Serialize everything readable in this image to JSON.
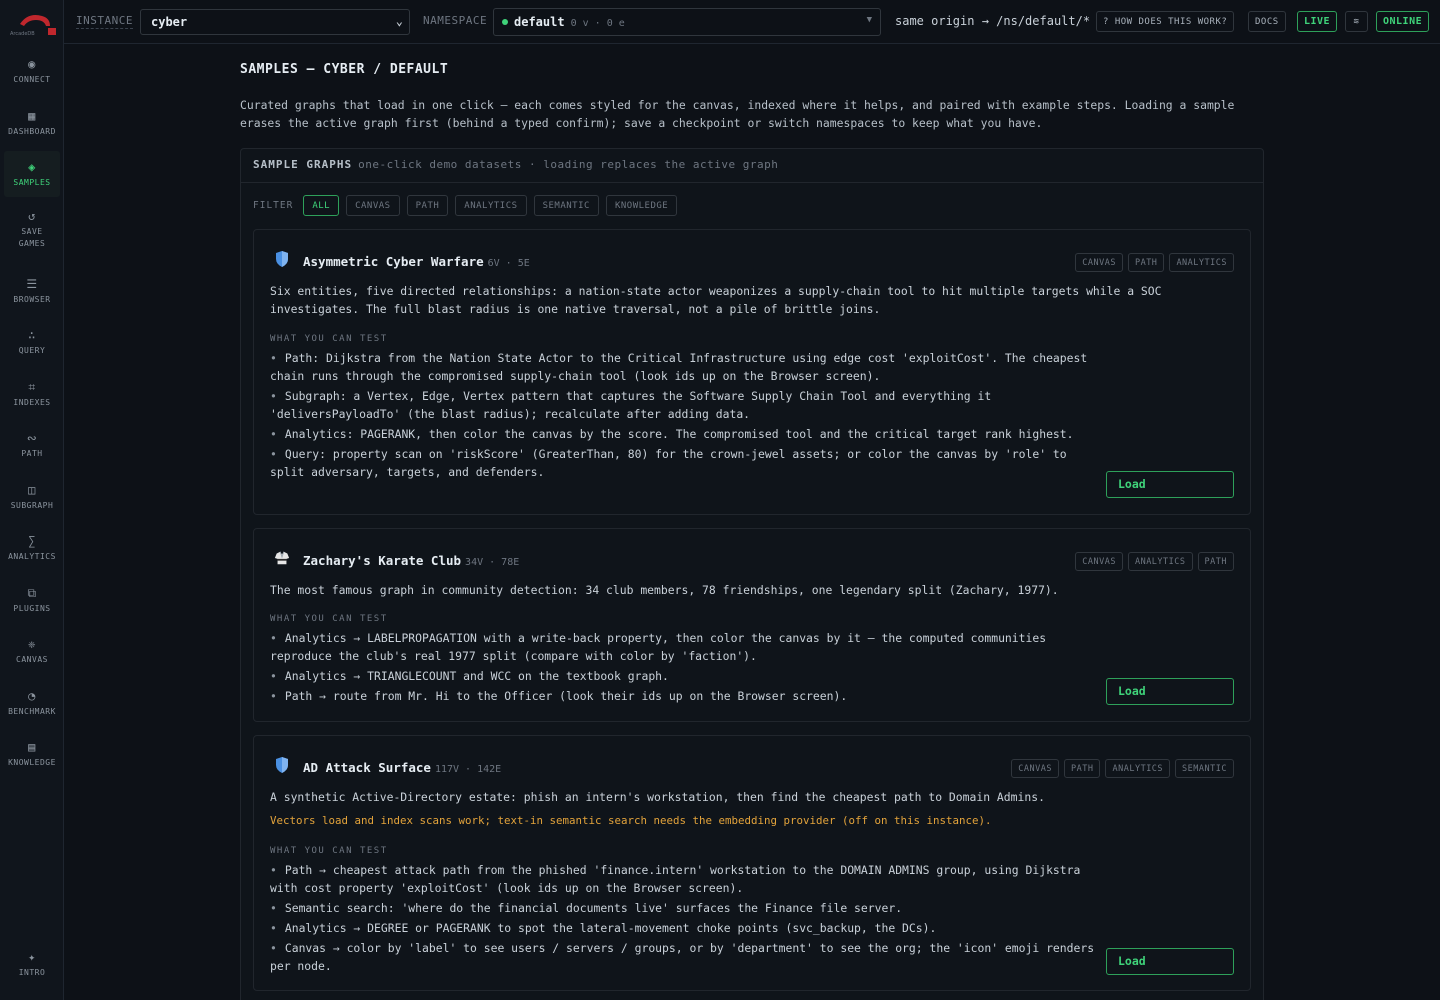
{
  "app": {
    "logo_text": "ArcadeDB"
  },
  "sidebar": {
    "items": [
      {
        "label": "CONNECT",
        "icon": "◉"
      },
      {
        "label": "DASHBOARD",
        "icon": "▦"
      },
      {
        "label": "SAMPLES",
        "icon": "◈"
      },
      {
        "label": "SAVE GAMES",
        "icon": "↺"
      },
      {
        "label": "BROWSER",
        "icon": "☰"
      },
      {
        "label": "QUERY",
        "icon": "∴"
      },
      {
        "label": "INDEXES",
        "icon": "⌗"
      },
      {
        "label": "PATH",
        "icon": "∾"
      },
      {
        "label": "SUBGRAPH",
        "icon": "◫"
      },
      {
        "label": "ANALYTICS",
        "icon": "∑"
      },
      {
        "label": "PLUGINS",
        "icon": "⧉"
      },
      {
        "label": "CANVAS",
        "icon": "❈"
      },
      {
        "label": "BENCHMARK",
        "icon": "◔"
      },
      {
        "label": "KNOWLEDGE",
        "icon": "▤"
      }
    ],
    "intro": {
      "label": "INTRO",
      "icon": "✦"
    }
  },
  "topbar": {
    "instance_label": "INSTANCE",
    "instance_value": "cyber",
    "namespace_label": "NAMESPACE",
    "namespace_value": "default",
    "namespace_meta": "0 v · 0 e",
    "origin_text": "same origin → /ns/default/*",
    "help_label": "? HOW DOES THIS WORK?",
    "docs_label": "DOCS",
    "live_label": "LIVE",
    "theme_icon": "≋",
    "online_label": "ONLINE"
  },
  "page": {
    "title": "SAMPLES  — CYBER / DEFAULT",
    "intro": "Curated graphs that load in one click — each comes styled for the canvas, indexed where it helps, and paired with example steps. Loading a sample erases the active graph first (behind a typed confirm); save a checkpoint or switch namespaces to keep what you have."
  },
  "panel": {
    "title": "SAMPLE GRAPHS",
    "subtitle": "one-click demo datasets · loading replaces the active graph",
    "filter_label": "FILTER",
    "filters": [
      "ALL",
      "CANVAS",
      "PATH",
      "ANALYTICS",
      "SEMANTIC",
      "KNOWLEDGE"
    ]
  },
  "cards": [
    {
      "title": "Asymmetric Cyber Warfare",
      "meta": "6V · 5E",
      "tags": [
        "CANVAS",
        "PATH",
        "ANALYTICS"
      ],
      "description": "Six entities, five directed relationships: a nation-state actor weaponizes a supply-chain tool to hit multiple targets while a SOC investigates. The full blast radius is one native traversal, not a pile of brittle joins.",
      "warning": "",
      "wyct_label": "WHAT YOU CAN TEST",
      "bullets": [
        "Path: Dijkstra from the Nation State Actor to the Critical Infrastructure using edge cost 'exploitCost'. The cheapest chain runs through the compromised supply-chain tool (look ids up on the Browser screen).",
        "Subgraph: a Vertex, Edge, Vertex pattern that captures the Software Supply Chain Tool and everything it 'deliversPayloadTo' (the blast radius); recalculate after adding data.",
        "Analytics: PAGERANK, then color the canvas by the score. The compromised tool and the critical target rank highest.",
        "Query: property scan on 'riskScore' (GreaterThan, 80) for the crown-jewel assets; or color the canvas by 'role' to split adversary, targets, and defenders."
      ],
      "load_label": "Load"
    },
    {
      "title": "Zachary's Karate Club",
      "meta": "34V · 78E",
      "tags": [
        "CANVAS",
        "ANALYTICS",
        "PATH"
      ],
      "description": "The most famous graph in community detection: 34 club members, 78 friendships, one legendary split (Zachary, 1977).",
      "warning": "",
      "wyct_label": "WHAT YOU CAN TEST",
      "bullets": [
        "Analytics → LABELPROPAGATION with a write-back property, then color the canvas by it — the computed communities reproduce the club's real 1977 split (compare with color by 'faction').",
        "Analytics → TRIANGLECOUNT and WCC on the textbook graph.",
        "Path → route from Mr. Hi to the Officer (look their ids up on the Browser screen)."
      ],
      "load_label": "Load"
    },
    {
      "title": "AD Attack Surface",
      "meta": "117V · 142E",
      "tags": [
        "CANVAS",
        "PATH",
        "ANALYTICS",
        "SEMANTIC"
      ],
      "description": "A synthetic Active-Directory estate: phish an intern's workstation, then find the cheapest path to Domain Admins.",
      "warning": "Vectors load and index scans work; text-in semantic search needs the embedding provider (off on this instance).",
      "wyct_label": "WHAT YOU CAN TEST",
      "bullets": [
        "Path → cheapest attack path from the phished 'finance.intern' workstation to the DOMAIN ADMINS group, using Dijkstra with cost property 'exploitCost' (look ids up on the Browser screen).",
        "Semantic search: 'where do the financial documents live' surfaces the Finance file server.",
        "Analytics → DEGREE or PAGERANK to spot the lateral-movement choke points (svc_backup, the DCs).",
        "Canvas → color by 'label' to see users / servers / groups, or by 'department' to see the org; the 'icon' emoji renders per node."
      ],
      "load_label": "Load"
    }
  ]
}
